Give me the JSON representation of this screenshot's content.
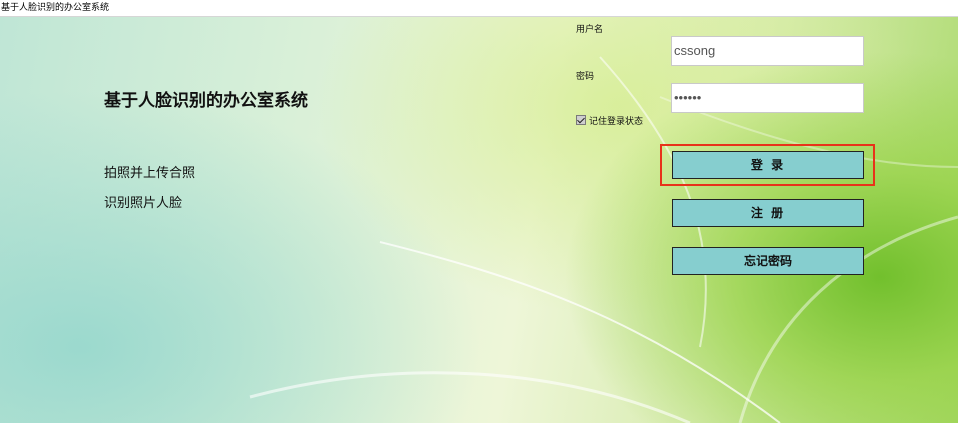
{
  "window": {
    "title": "基于人脸识别的办公室系统"
  },
  "main": {
    "app_title": "基于人脸识别的办公室系统",
    "links": [
      {
        "label": "拍照并上传合照"
      },
      {
        "label": "识别照片人脸"
      }
    ]
  },
  "login": {
    "username_label": "用户名",
    "username_value": "cssong",
    "password_label": "密码",
    "password_value": "••••••",
    "remember_label": "记住登录状态",
    "remember_checked": true,
    "login_button": "登 录",
    "register_button": "注 册",
    "forgot_button": "忘记密码"
  },
  "colors": {
    "button_bg": "#86cecf",
    "highlight": "#e8321a"
  }
}
